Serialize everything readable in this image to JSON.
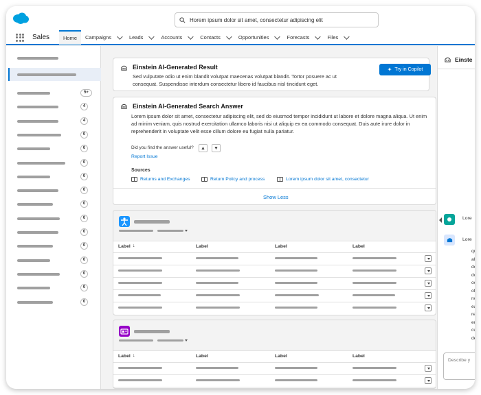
{
  "header": {
    "search": {
      "value": "Horem ipsum dolor sit amet, consectetur adipiscing elit"
    }
  },
  "nav": {
    "app_name": "Sales",
    "items": [
      {
        "label": "Home",
        "active": true,
        "chevron": false
      },
      {
        "label": "Campaigns",
        "chevron": true
      },
      {
        "label": "Leads",
        "chevron": true
      },
      {
        "label": "Accounts",
        "chevron": true
      },
      {
        "label": "Contacts",
        "chevron": true
      },
      {
        "label": "Opportunities",
        "chevron": true
      },
      {
        "label": "Forecasts",
        "chevron": true
      },
      {
        "label": "Files",
        "chevron": true
      }
    ]
  },
  "sidebar": {
    "badges": [
      "5+",
      "4",
      "4",
      "0",
      "0",
      "0",
      "0",
      "0",
      "0",
      "0",
      "0",
      "0",
      "0",
      "0",
      "0",
      "0"
    ]
  },
  "result_card": {
    "title": "Einstein AI-Generated Result",
    "body": "Sed vulputate odio ut enim blandit volutpat maecenas volutpat blandit. Tortor posuere ac ut consequat. Suspendisse interdum consectetur libero id faucibus nisl tincidunt eget.",
    "button_label": "Try in Copilot"
  },
  "answer_card": {
    "title": "Einstein AI-Generated Search Answer",
    "body": "Lorem ipsum dolor sit amet, consectetur adipiscing elit, sed do eiusmod tempor incididunt ut labore et dolore magna aliqua. Ut enim ad minim veniam, quis nostrud exercitation ullamco laboris nisi ut aliquip ex ea commodo consequat. Duis aute irure dolor in reprehenderit in voluptate velit esse cillum dolore eu fugiat nulla pariatur.",
    "feedback_question": "Did you find the answer useful?",
    "report_issue": "Report Issue",
    "sources_label": "Sources",
    "sources": [
      "Returns and Exchanges",
      "Return Policy and process",
      "Lorem ipsum dolor sit amet, consectetur"
    ],
    "show_less": "Show Less"
  },
  "tables": [
    {
      "icon_color": "#1b96ff",
      "columns": [
        "Label",
        "Label",
        "Label",
        "Label"
      ],
      "first_column_sorted": true
    },
    {
      "icon_color": "#9602c7",
      "columns": [
        "Label",
        "Label",
        "Label",
        "Label"
      ],
      "first_column_sorted": true
    }
  ],
  "right_panel": {
    "title": "Einste",
    "msg1": "Lore",
    "msg2": "Lore",
    "msg2_lines": [
      "qu",
      "ali",
      "do",
      "do",
      "occ",
      "off",
      "no",
      "ea",
      "rep",
      "eu",
      "cup",
      "des"
    ],
    "input_placeholder": "Describe y"
  },
  "colors": {
    "brand": "#0176d3",
    "user_avatar": "#06a59a"
  }
}
